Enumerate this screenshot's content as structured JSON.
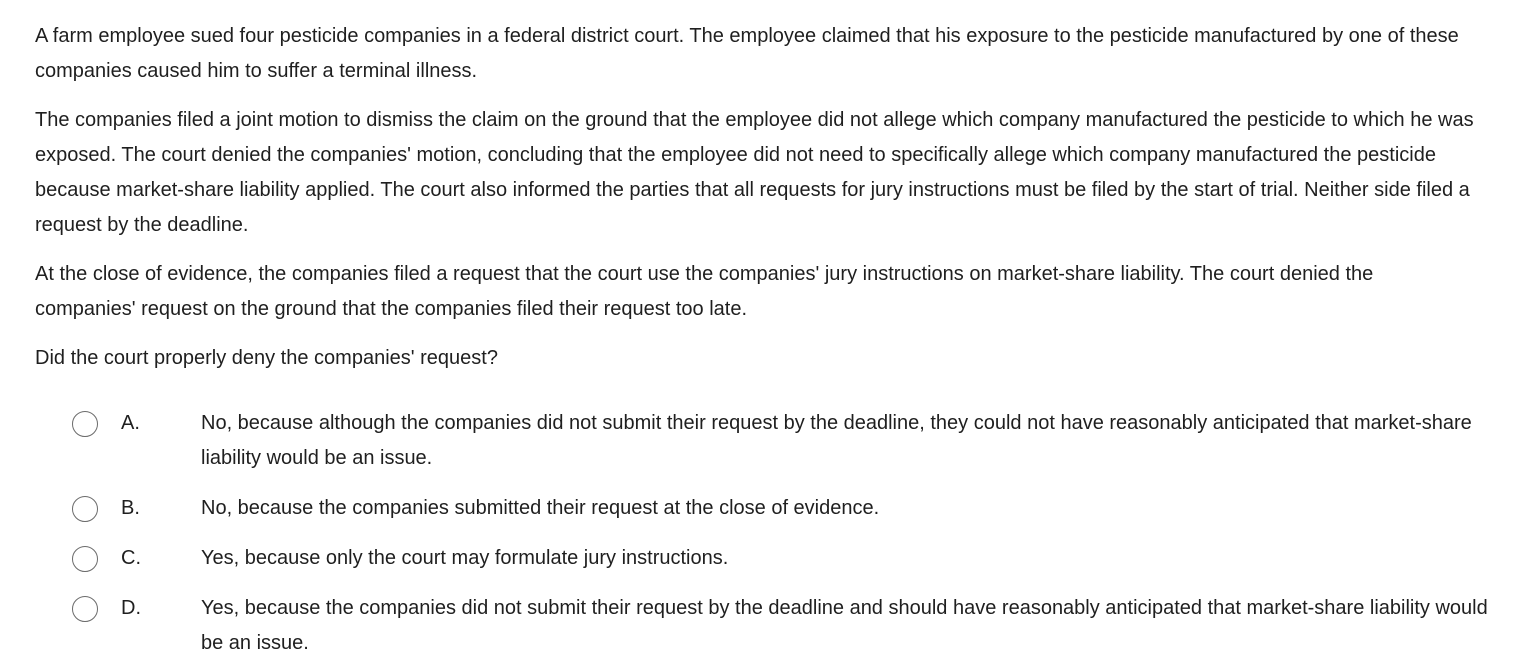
{
  "question": {
    "paragraphs": [
      "A farm employee sued four pesticide companies in a federal district court.  The employee claimed that his exposure to the pesticide manufactured by one of these companies caused him to suffer a terminal illness.",
      "The companies filed a joint motion to dismiss the claim on the ground that the employee did not allege which company manufactured the pesticide to which he was exposed.  The court denied the companies' motion, concluding that the employee did not need to specifically allege which company manufactured the pesticide because market-share liability applied.  The court also informed the parties that all requests for jury instructions must be filed by the start of trial.  Neither side filed a request by the deadline.",
      "At the close of evidence, the companies filed a request that the court use the companies' jury instructions on market-share liability.  The court denied the companies' request on the ground that the companies filed their request too late.",
      "Did the court properly deny the companies' request?"
    ]
  },
  "options": [
    {
      "letter": "A.",
      "text": "No, because although the companies did not submit their request by the deadline, they could not have reasonably anticipated that market-share liability would be an issue."
    },
    {
      "letter": "B.",
      "text": "No, because the companies submitted their request at the close of evidence."
    },
    {
      "letter": "C.",
      "text": "Yes, because only the court may formulate jury instructions."
    },
    {
      "letter": "D.",
      "text": "Yes, because the companies did not submit their request by the deadline and should have reasonably anticipated that market-share liability would be an issue."
    }
  ],
  "colors": {
    "text": "#1f1f1f",
    "radio_border": "#6b6b6b",
    "background": "#ffffff"
  }
}
